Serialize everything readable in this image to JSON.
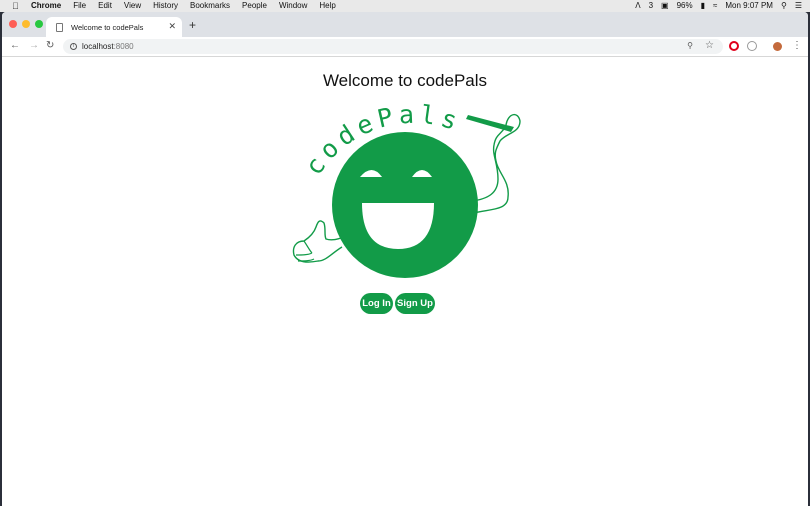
{
  "menubar": {
    "app": "Chrome",
    "items": [
      "File",
      "Edit",
      "View",
      "History",
      "Bookmarks",
      "People",
      "Window",
      "Help"
    ],
    "status": {
      "badge_count": "3",
      "battery": "96%",
      "datetime": "Mon 9:07 PM"
    }
  },
  "browser": {
    "tab_title": "Welcome to codePals",
    "address": {
      "host": "localhost",
      "port": ":8080"
    }
  },
  "page": {
    "heading": "Welcome to codePals",
    "logo_text": "codePals",
    "login_label": "Log In",
    "signup_label": "Sign Up"
  },
  "colors": {
    "brand_green": "#129b48",
    "tab_strip": "#dee1e6"
  }
}
